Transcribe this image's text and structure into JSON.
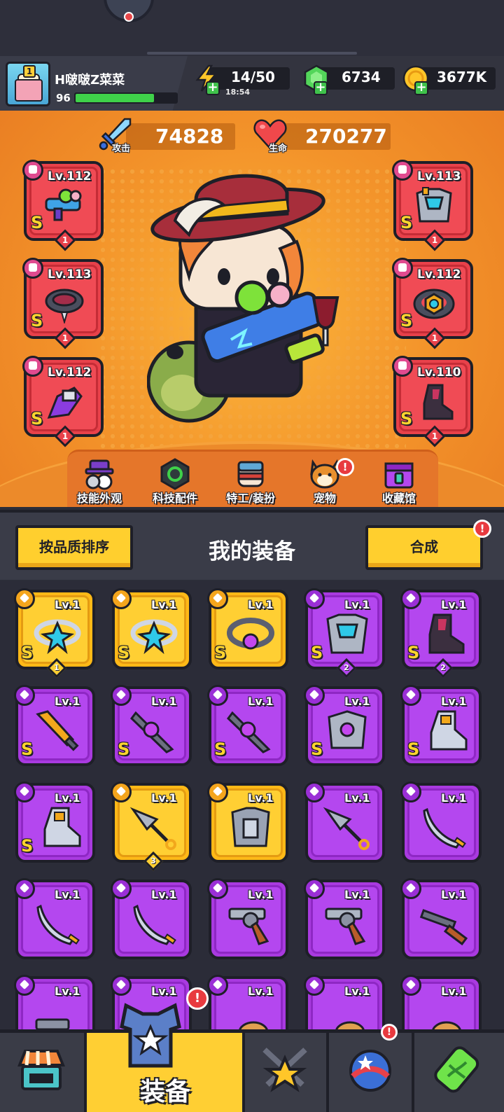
{
  "player": {
    "name": "H啵啵Z菜菜",
    "level": "96",
    "exp_fraction": 0.78,
    "avatar_rank": "1"
  },
  "resources": {
    "energy": {
      "value": "14/50",
      "timer": "18:54",
      "icon": "lightning-icon"
    },
    "gems": {
      "value": "6734",
      "icon": "green-gem-icon"
    },
    "coins": {
      "value": "3677K",
      "icon": "gold-coin-icon"
    }
  },
  "stats": {
    "attack": {
      "label": "攻击",
      "value": "74828",
      "icon": "sword-icon"
    },
    "hp": {
      "label": "生命",
      "value": "270277",
      "icon": "heart-icon"
    }
  },
  "equipped": [
    {
      "slot": "weapon",
      "level": "Lv.112",
      "grade": "S",
      "count": "1",
      "icon": "water-gun-icon"
    },
    {
      "slot": "necklace",
      "level": "Lv.113",
      "grade": "S",
      "count": "1",
      "icon": "spiked-collar-icon"
    },
    {
      "slot": "gloves",
      "level": "Lv.112",
      "grade": "S",
      "count": "1",
      "icon": "gauntlet-icon"
    },
    {
      "slot": "armor",
      "level": "Lv.113",
      "grade": "S",
      "count": "1",
      "icon": "armor-icon"
    },
    {
      "slot": "belt",
      "level": "Lv.112",
      "grade": "S",
      "count": "1",
      "icon": "belt-icon"
    },
    {
      "slot": "boots",
      "level": "Lv.110",
      "grade": "S",
      "count": "1",
      "icon": "boots-icon"
    }
  ],
  "hero_menu": [
    {
      "label": "技能外观",
      "icon": "hat-ball-icon",
      "alert": false
    },
    {
      "label": "科技配件",
      "icon": "tech-chip-icon",
      "alert": false
    },
    {
      "label": "特工/装扮",
      "icon": "agent-mask-icon",
      "alert": false
    },
    {
      "label": "宠物",
      "icon": "dog-pet-icon",
      "alert": true
    },
    {
      "label": "收藏馆",
      "icon": "collection-chest-icon",
      "alert": false
    }
  ],
  "inventory_header": {
    "sort_label": "按品质排序",
    "title": "我的装备",
    "merge_label": "合成",
    "merge_alert": "!"
  },
  "inventory": [
    {
      "rarity": "gold",
      "level": "Lv.1",
      "grade": "S",
      "count": "1",
      "icon": "star-ring-icon"
    },
    {
      "rarity": "gold",
      "level": "Lv.1",
      "grade": "S",
      "count": "",
      "icon": "star-ring-icon"
    },
    {
      "rarity": "gold",
      "level": "Lv.1",
      "grade": "S",
      "count": "",
      "icon": "orb-belt-icon"
    },
    {
      "rarity": "purple",
      "level": "Lv.1",
      "grade": "S",
      "count": "2",
      "icon": "armor-icon"
    },
    {
      "rarity": "purple",
      "level": "Lv.1",
      "grade": "S",
      "count": "2",
      "icon": "boots-icon"
    },
    {
      "rarity": "purple",
      "level": "Lv.1",
      "grade": "S",
      "count": "",
      "icon": "flame-sword-icon"
    },
    {
      "rarity": "purple",
      "level": "Lv.1",
      "grade": "S",
      "count": "",
      "icon": "void-blade-icon"
    },
    {
      "rarity": "purple",
      "level": "Lv.1",
      "grade": "S",
      "count": "",
      "icon": "void-blade-icon"
    },
    {
      "rarity": "purple",
      "level": "Lv.1",
      "grade": "S",
      "count": "",
      "icon": "orb-armor-icon"
    },
    {
      "rarity": "purple",
      "level": "Lv.1",
      "grade": "S",
      "count": "",
      "icon": "mech-boots-icon"
    },
    {
      "rarity": "purple",
      "level": "Lv.1",
      "grade": "S",
      "count": "",
      "icon": "mech-boots-icon"
    },
    {
      "rarity": "gold",
      "level": "Lv.1",
      "grade": "",
      "count": "3",
      "icon": "kunai-icon"
    },
    {
      "rarity": "gold",
      "level": "Lv.1",
      "grade": "",
      "count": "",
      "icon": "plate-armor-icon"
    },
    {
      "rarity": "purple",
      "level": "Lv.1",
      "grade": "",
      "count": "",
      "icon": "kunai-icon"
    },
    {
      "rarity": "purple",
      "level": "Lv.1",
      "grade": "",
      "count": "",
      "icon": "scimitar-icon"
    },
    {
      "rarity": "purple",
      "level": "Lv.1",
      "grade": "",
      "count": "",
      "icon": "scimitar-icon"
    },
    {
      "rarity": "purple",
      "level": "Lv.1",
      "grade": "",
      "count": "",
      "icon": "scimitar-icon"
    },
    {
      "rarity": "purple",
      "level": "Lv.1",
      "grade": "",
      "count": "",
      "icon": "revolver-icon"
    },
    {
      "rarity": "purple",
      "level": "Lv.1",
      "grade": "",
      "count": "",
      "icon": "revolver-icon"
    },
    {
      "rarity": "purple",
      "level": "Lv.1",
      "grade": "",
      "count": "",
      "icon": "shotgun-icon"
    },
    {
      "rarity": "purple",
      "level": "Lv.1",
      "grade": "",
      "count": "",
      "icon": "pistol-icon"
    },
    {
      "rarity": "purple",
      "level": "Lv.1",
      "grade": "",
      "count": "",
      "icon": "unknown-item-icon"
    },
    {
      "rarity": "purple",
      "level": "Lv.1",
      "grade": "",
      "count": "",
      "icon": "rocket-icon"
    },
    {
      "rarity": "purple",
      "level": "Lv.1",
      "grade": "",
      "count": "",
      "icon": "rocket-icon"
    },
    {
      "rarity": "purple",
      "level": "Lv.1",
      "grade": "",
      "count": "",
      "icon": "rocket-icon"
    }
  ],
  "bottom_nav": [
    {
      "id": "shop",
      "label": "",
      "icon": "shop-stall-icon",
      "alert": false
    },
    {
      "id": "equip",
      "label": "装备",
      "icon": "equip-armor-icon",
      "alert": true,
      "active": true
    },
    {
      "id": "battle",
      "label": "",
      "icon": "crossed-swords-star-icon",
      "alert": false
    },
    {
      "id": "events",
      "label": "",
      "icon": "star-ball-icon",
      "alert": true
    },
    {
      "id": "lab",
      "label": "",
      "icon": "dna-capsule-icon",
      "alert": false
    }
  ],
  "colors": {
    "hero_bg": "#f3932a",
    "equip_slot_red": "#e8414a",
    "rarity_gold": "#ffcf33",
    "rarity_purple": "#b447ef",
    "button_yellow": "#ffcf2e",
    "panel_dark": "#2b2c38"
  }
}
